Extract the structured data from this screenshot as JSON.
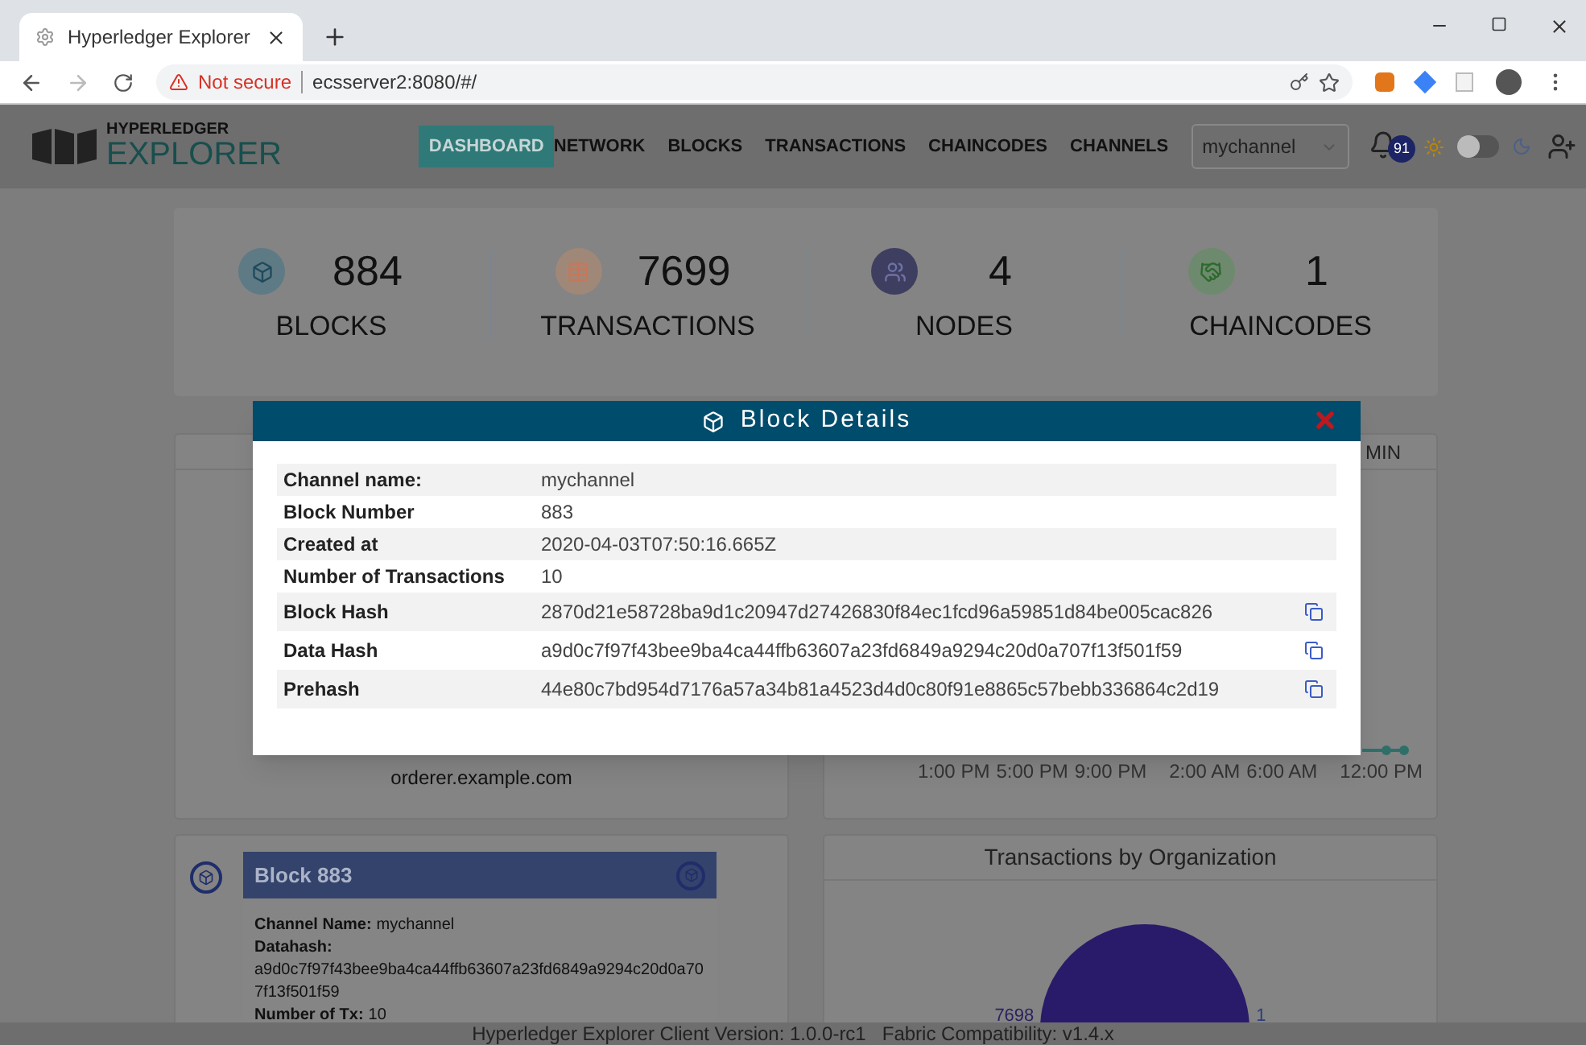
{
  "browser": {
    "tab_title": "Hyperledger Explorer",
    "security": "Not secure",
    "url": "ecsserver2:8080/#/"
  },
  "header": {
    "logo_top": "HYPERLEDGER",
    "logo_bottom": "EXPLORER",
    "nav": [
      {
        "label": "DASHBOARD",
        "selected": true
      },
      {
        "label": "NETWORK",
        "selected": false
      },
      {
        "label": "BLOCKS",
        "selected": false
      },
      {
        "label": "TRANSACTIONS",
        "selected": false
      },
      {
        "label": "CHAINCODES",
        "selected": false
      },
      {
        "label": "CHANNELS",
        "selected": false
      }
    ],
    "channel": "mychannel",
    "notifications": "91",
    "dark_mode": false
  },
  "stats": [
    {
      "kind": "blocks",
      "value": "884",
      "label": "BLOCKS",
      "color": "#5e7a85"
    },
    {
      "kind": "transactions",
      "value": "7699",
      "label": "TRANSACTIONS",
      "color": "#a08878"
    },
    {
      "kind": "nodes",
      "value": "4",
      "label": "NODES",
      "color": "#3e3f60"
    },
    {
      "kind": "chaincodes",
      "value": "1",
      "label": "CHAINCODES",
      "color": "#6e8a6e"
    }
  ],
  "peers_panel": {
    "text": "orderer.example.com"
  },
  "time_panel": {
    "tab": "MIN",
    "x_labels": [
      "1:00 PM",
      "5:00 PM",
      "9:00 PM",
      "2:00 AM",
      "6:00 AM",
      "12:00 PM"
    ]
  },
  "block_card": {
    "title": "Block 883",
    "fields": [
      {
        "label": "Channel Name:",
        "value": "mychannel"
      },
      {
        "label": "Datahash:",
        "value": "a9d0c7f97f43bee9ba4ca44ffb63607a23fd6849a9294c20d0a707f13f501f59"
      },
      {
        "label": "Number of Tx:",
        "value": "10"
      }
    ]
  },
  "org_panel": {
    "title": "Transactions by Organization",
    "labels": [
      "7698",
      "1"
    ]
  },
  "modal": {
    "title": "Block Details",
    "rows": [
      {
        "label": "Channel name:",
        "value": "mychannel",
        "copyable": false
      },
      {
        "label": "Block Number",
        "value": "883",
        "copyable": false
      },
      {
        "label": "Created at",
        "value": "2020-04-03T07:50:16.665Z",
        "copyable": false
      },
      {
        "label": "Number of Transactions",
        "value": "10",
        "copyable": false
      },
      {
        "label": "Block Hash",
        "value": "2870d21e58728ba9d1c20947d27426830f84ec1fcd96a59851d84be005cac826",
        "copyable": true
      },
      {
        "label": "Data Hash",
        "value": "a9d0c7f97f43bee9ba4ca44ffb63607a23fd6849a9294c20d0a707f13f501f59",
        "copyable": true
      },
      {
        "label": "Prehash",
        "value": "44e80c7bd954d7176a57a34b81a4523d4d0c80f91e8865c57bebb336864c2d19",
        "copyable": true
      }
    ]
  },
  "footer": {
    "version": "Hyperledger Explorer Client Version: 1.0.0-rc1",
    "compat": "Fabric Compatibility: v1.4.x"
  }
}
